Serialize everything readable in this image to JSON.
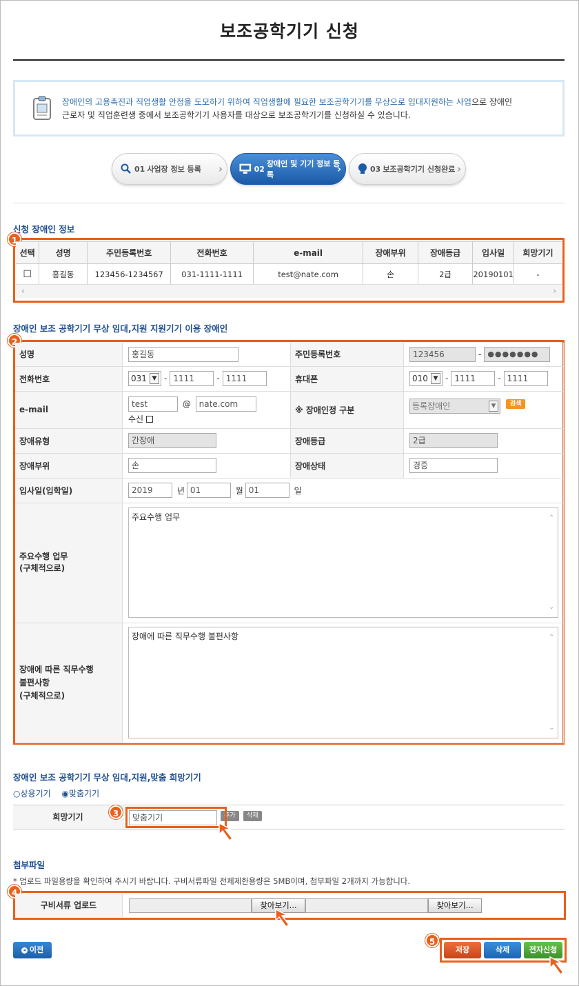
{
  "page": {
    "title": "보조공학기기 신청"
  },
  "info": {
    "highlight": "장애인의 고용촉진과 직업생활 안정을 도모하기 위하여 직업생활에 필요한 보조공학기기를 무상으로 임대지원하는 사업",
    "text_tail": "으로 장애인",
    "line2": "근로자 및 직업훈련생 중에서 보조공학기기 사용자를 대상으로 보조공학기기를 신청하실 수 있습니다."
  },
  "steps": [
    {
      "num": "01",
      "label": "사업장 정보 등록",
      "icon": "search-icon",
      "active": false
    },
    {
      "num": "02",
      "label": "장애인 및 기기 정보 등록",
      "icon": "monitor-icon",
      "active": true
    },
    {
      "num": "03",
      "label": "보조공학기기 신청완료",
      "icon": "lightbulb-icon",
      "active": false
    }
  ],
  "section1": {
    "title": "신청 장애인 정보",
    "badge": "1",
    "headers": [
      "선택",
      "성명",
      "주민등록번호",
      "전화번호",
      "e-mail",
      "장애부위",
      "장애등급",
      "입사일",
      "희망기기"
    ],
    "row": {
      "check": "☐",
      "name": "홍길동",
      "rrn": "123456-1234567",
      "phone": "031-1111-1111",
      "email": "test@nate.com",
      "part": "손",
      "grade": "2급",
      "hire": "20190101",
      "device": "-"
    }
  },
  "section2": {
    "title": "장애인 보조 공학기기 무상 임대,지원 지원기기 이용 장애인",
    "badge": "2",
    "labels": {
      "name": "성명",
      "rrn": "주민등록번호",
      "phone": "전화번호",
      "mobile": "휴대폰",
      "email": "e-mail",
      "cert": "※ 장애인정 구분",
      "type": "장애유형",
      "grade": "장애등급",
      "part": "장애부위",
      "status": "장애상태",
      "hire": "입사일(입학일)",
      "duty": "주요수행 업무\n(구체적으로)",
      "inconv": "장애에 따른 직무수행\n불편사항\n(구체적으로)"
    },
    "values": {
      "name": "홍길동",
      "rrn1": "123456",
      "rrn2": "●●●●●●●",
      "phone1": "031",
      "phone2": "1111",
      "phone3": "1111",
      "mobile1": "010",
      "mobile2": "1111",
      "mobile3": "1111",
      "email_id": "test",
      "at": "@",
      "email_domain": "nate.com",
      "receive": "수신",
      "cert": "등록장애인",
      "search_btn": "검색",
      "type": "간장애",
      "grade": "2급",
      "part": "손",
      "status": "경증",
      "year": "2019",
      "year_unit": "년",
      "month": "01",
      "month_unit": "월",
      "day": "01",
      "day_unit": "일",
      "duty": "주요수행 업무",
      "inconv": "장애에 따른 직무수행 불편사항"
    }
  },
  "section3": {
    "title": "장애인 보조 공학기기 무상 임대,지원,맞춤 희망기기",
    "radio1": "상용기기",
    "radio2": "맞춤기기",
    "label": "희망기기",
    "value": "맞춤기기",
    "badge": "3",
    "btn_add": "추가",
    "btn_del": "삭제"
  },
  "section4": {
    "title": "첨부파일",
    "note": "* 업로드 파일용량을 확인하여 주시기 바랍니다. 구비서류파일 전체제한용량은 5MB이며, 첨부파일 2개까지 가능합니다.",
    "label": "구비서류 업로드",
    "browse": "찾아보기...",
    "badge": "4"
  },
  "buttons": {
    "prev": "이전",
    "save": "저장",
    "delete": "삭제",
    "apply": "전자신청",
    "badge": "5"
  },
  "colors": {
    "accent": "#e8601c",
    "blue": "#1f4f8f",
    "save": "#d9531e",
    "delete": "#2a79c8",
    "apply": "#4ea83a"
  }
}
